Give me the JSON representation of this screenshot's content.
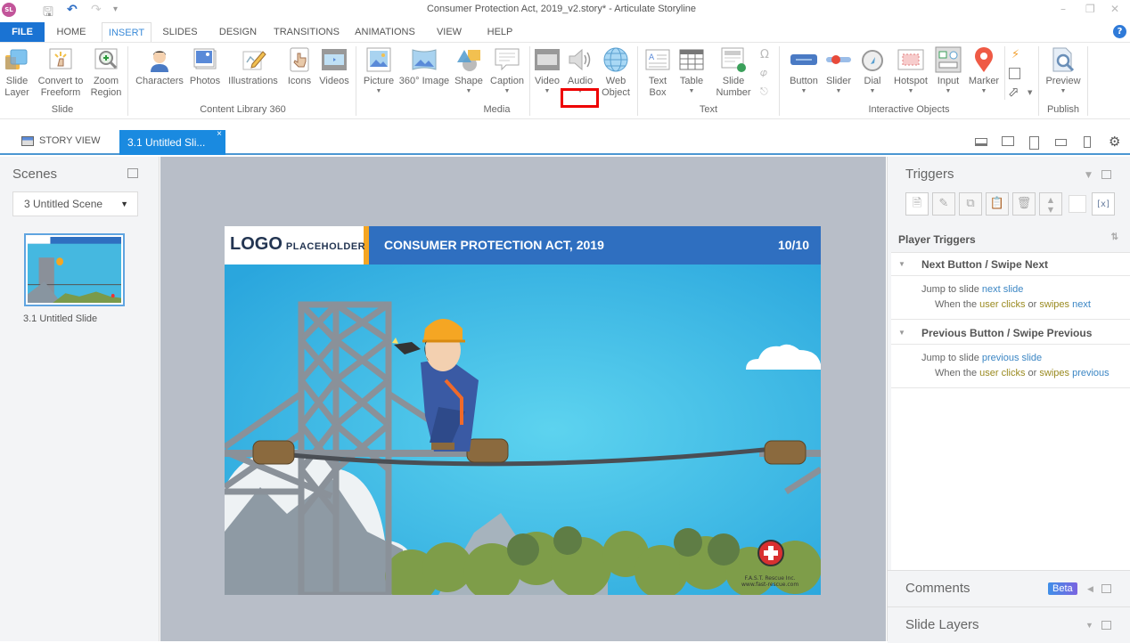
{
  "window": {
    "title": "Consumer Protection Act, 2019_v2.story* - Articulate Storyline",
    "app_logo": "SL",
    "controls": [
      "minimize-icon",
      "restore-icon",
      "close-icon"
    ]
  },
  "quick_access": [
    "save-icon",
    "undo-icon",
    "redo-icon",
    "customize-icon"
  ],
  "menu": {
    "tabs": [
      "FILE",
      "HOME",
      "INSERT",
      "SLIDES",
      "DESIGN",
      "TRANSITIONS",
      "ANIMATIONS",
      "VIEW",
      "HELP"
    ],
    "active": "INSERT"
  },
  "ribbon": {
    "groups": [
      {
        "label": "Slide",
        "items": [
          {
            "label": "Slide\nLayer",
            "icon": "slide-layer-icon"
          },
          {
            "label": "Convert to\nFreeform",
            "icon": "convert-freeform-icon"
          },
          {
            "label": "Zoom\nRegion",
            "icon": "zoom-region-icon"
          }
        ]
      },
      {
        "label": "Content Library 360",
        "items": [
          {
            "label": "Characters",
            "icon": "character-icon"
          },
          {
            "label": "Photos",
            "icon": "photo-icon"
          },
          {
            "label": "Illustrations",
            "icon": "illustration-icon"
          },
          {
            "label": "Icons",
            "icon": "hand-pointer-icon"
          },
          {
            "label": "Videos",
            "icon": "film-icon"
          }
        ]
      },
      {
        "label": "Media",
        "items": [
          {
            "label": "Picture",
            "icon": "picture-icon",
            "dropdown": true
          },
          {
            "label": "360° Image",
            "icon": "panorama-icon"
          },
          {
            "label": "Shape",
            "icon": "shape-icon",
            "dropdown": true
          },
          {
            "label": "Caption",
            "icon": "caption-icon",
            "dropdown": true
          },
          {
            "label": "Video",
            "icon": "video-icon",
            "dropdown": true
          },
          {
            "label": "Audio",
            "icon": "audio-icon",
            "dropdown": true,
            "highlighted": true
          },
          {
            "label": "Web\nObject",
            "icon": "globe-icon"
          }
        ]
      },
      {
        "label": "Text",
        "items": [
          {
            "label": "Text\nBox",
            "icon": "text-box-icon"
          },
          {
            "label": "Table",
            "icon": "table-icon",
            "dropdown": true
          },
          {
            "label": "Slide\nNumber",
            "icon": "slide-number-icon",
            "dropdown": true
          }
        ],
        "small_icons": [
          "omega-icon",
          "formula-icon",
          "reference-icon"
        ]
      },
      {
        "label": "Interactive Objects",
        "items": [
          {
            "label": "Button",
            "icon": "button-icon",
            "dropdown": true
          },
          {
            "label": "Slider",
            "icon": "slider-icon",
            "dropdown": true
          },
          {
            "label": "Dial",
            "icon": "dial-icon",
            "dropdown": true
          },
          {
            "label": "Hotspot",
            "icon": "hotspot-icon",
            "dropdown": true
          },
          {
            "label": "Input",
            "icon": "input-icon",
            "dropdown": true
          },
          {
            "label": "Marker",
            "icon": "marker-icon",
            "dropdown": true
          }
        ],
        "small_icons": [
          "trigger-icon",
          "scrolling-panel-icon",
          "mouse-cursor-icon"
        ]
      },
      {
        "label": "Publish",
        "items": [
          {
            "label": "Preview",
            "icon": "preview-icon",
            "dropdown": true
          }
        ]
      }
    ]
  },
  "doc_tabs": {
    "story_view": "STORY VIEW",
    "active_slide": "3.1 Untitled Sli...",
    "close": "×",
    "device_icons": [
      "laptop-icon",
      "desktop-icon",
      "tablet-portrait-icon",
      "tablet-landscape-icon",
      "phone-icon",
      "gear-icon"
    ]
  },
  "scenes_panel": {
    "title": "Scenes",
    "selected_scene": "3 Untitled Scene",
    "slides": [
      {
        "label": "3.1 Untitled Slide"
      }
    ]
  },
  "slide": {
    "logo": "LOGO",
    "logo_sub": "PLACEHOLDER",
    "title": "CONSUMER PROTECTION ACT, 2019",
    "page": "10/10",
    "brand_line1": "F.A.S.T. Rescue Inc.",
    "brand_line2": "www.fast-rescue.com",
    "colors": {
      "header": "#2f6fc0",
      "accent": "#f5a623",
      "sky": "#45b8e0"
    }
  },
  "triggers_panel": {
    "title": "Triggers",
    "toolbar": [
      "new-trigger-icon",
      "edit-trigger-icon",
      "copy-icon",
      "paste-icon",
      "delete-icon",
      "move-up-down-icon",
      "blank",
      "variables-icon"
    ],
    "section": "Player Triggers",
    "triggers": [
      {
        "name": "Next Button / Swipe Next",
        "action_prefix": "Jump to slide ",
        "action_target": "next slide",
        "cond_prefix": "When the ",
        "cond_user": "user",
        "cond_mid1": " ",
        "cond_event": "clicks",
        "cond_mid2": " or ",
        "cond_event2": "swipes",
        "cond_mid3": " ",
        "cond_target": "next"
      },
      {
        "name": "Previous Button / Swipe Previous",
        "action_prefix": "Jump to slide ",
        "action_target": "previous slide",
        "cond_prefix": "When the ",
        "cond_user": "user",
        "cond_mid1": " ",
        "cond_event": "clicks",
        "cond_mid2": " or ",
        "cond_event2": "swipes",
        "cond_mid3": " ",
        "cond_target": "previous"
      }
    ]
  },
  "comments_panel": {
    "title": "Comments",
    "badge": "Beta"
  },
  "layers_panel": {
    "title": "Slide Layers"
  }
}
